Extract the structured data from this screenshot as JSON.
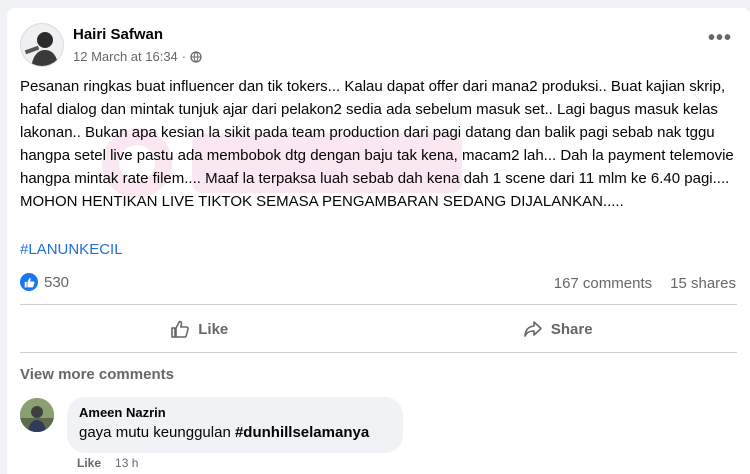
{
  "post": {
    "author": "Hairi Safwan",
    "timestamp": "12 March at 16:34",
    "separator": "·",
    "privacy_icon": "globe-icon",
    "more_label": "•••",
    "text": "Pesanan ringkas buat influencer dan tik tokers... Kalau dapat offer dari mana2 produksi.. Buat kajian skrip, hafal dialog dan mintak tunjuk ajar dari pelakon2 sedia ada sebelum masuk set.. Lagi bagus masuk kelas lakonan.. Bukan apa kesian la sikit pada team production dari pagi datang dan balik pagi sebab nak tggu hangpa setel live pastu ada membobok dtg dengan baju tak kena, macam2 lah... Dah la payment telemovie hangpa mintak rate filem.... Maaf la terpaksa luah sebab dah kena dah 1 scene dari 11 mlm ke 6.40 pagi.... MOHON HENTIKAN LIVE TIKTOK SEMASA PENGAMBARAN SEDANG DIJALANKAN.....",
    "hashtag": "#LANUNKECIL"
  },
  "engagement": {
    "reaction_count": "530",
    "comments": "167 comments",
    "shares": "15 shares"
  },
  "actions": {
    "like": "Like",
    "share": "Share"
  },
  "comments_section": {
    "view_more": "View more comments",
    "comment": {
      "author": "Ameen Nazrin",
      "text": "gaya mutu keunggulan",
      "tag": "#dunhillselamanya",
      "like_label": "Like",
      "age": "13 h"
    }
  },
  "colors": {
    "accent": "#1877f2",
    "hashtag": "#216fdb",
    "secondary_text": "#65676b",
    "background": "#f0f2f5"
  }
}
